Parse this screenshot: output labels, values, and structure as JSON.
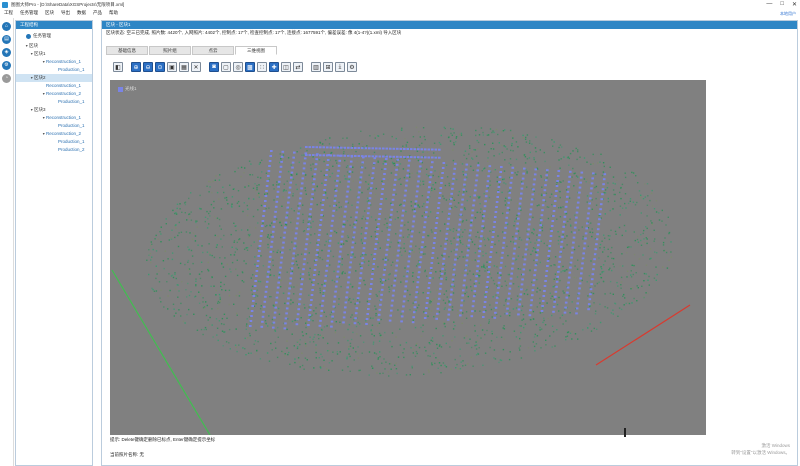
{
  "window": {
    "title": "图图大师Pro - [D:\\ShareData\\XGSProjects\\无限项目.xml]",
    "minimize": "—",
    "maximize": "□",
    "close": "✕",
    "user": "本地用户"
  },
  "menu": [
    "工程",
    "任务管理",
    "区块",
    "导出",
    "数据",
    "产品",
    "帮助"
  ],
  "left_rail": {
    "buttons": [
      {
        "icon": "home-icon",
        "glyph": "⌂"
      },
      {
        "icon": "folder-icon",
        "glyph": "▤"
      },
      {
        "icon": "layers-icon",
        "glyph": "◈"
      },
      {
        "icon": "settings-icon",
        "glyph": "⚙"
      },
      {
        "icon": "clock-icon",
        "glyph": "◔"
      }
    ]
  },
  "tree_panel": {
    "header": "工程结构",
    "manage_button": "任务管理",
    "items": [
      {
        "label": "区块",
        "level": 0,
        "caret": "▼"
      },
      {
        "label": "区块1",
        "level": 1,
        "caret": "▼"
      },
      {
        "label": "Reconstruction_1",
        "level": 2,
        "caret": "▼"
      },
      {
        "label": "Production_1",
        "level": 3,
        "caret": ""
      },
      {
        "label": "区块2",
        "level": 1,
        "caret": "▼",
        "selected": true
      },
      {
        "label": "Reconstruction_1",
        "level": 2,
        "caret": ""
      },
      {
        "label": "Reconstruction_2",
        "level": 2,
        "caret": "▼"
      },
      {
        "label": "Production_1",
        "level": 3,
        "caret": ""
      },
      {
        "label": "区块3",
        "level": 1,
        "caret": "▼"
      },
      {
        "label": "Reconstruction_1",
        "level": 2,
        "caret": "▼"
      },
      {
        "label": "Production_1",
        "level": 3,
        "caret": ""
      },
      {
        "label": "Reconstruction_2",
        "level": 2,
        "caret": "▼"
      },
      {
        "label": "Production_1",
        "level": 3,
        "caret": ""
      },
      {
        "label": "Production_2",
        "level": 3,
        "caret": ""
      }
    ]
  },
  "main": {
    "header": "区块 - 区块1",
    "info": "区块状态: 空三已完成, 照片数: 4420个, 入网照片: 4402个, 控制点: 17个, 检查控制点: 17个, 连接点: 1677591个, 偏差误差: 像 4(1-4?)(1.xml) 导入区块",
    "tabs": [
      {
        "label": "基础信息",
        "active": false
      },
      {
        "label": "照片组",
        "active": false
      },
      {
        "label": "点云",
        "active": false
      },
      {
        "label": "三维视图",
        "active": true
      }
    ],
    "toolbar": [
      {
        "icon": "camera-icon",
        "glyph": "◧",
        "blue": false
      },
      {
        "icon": "gap",
        "glyph": "",
        "blue": false
      },
      {
        "icon": "zoom-in-icon",
        "glyph": "⊕",
        "blue": true
      },
      {
        "icon": "zoom-out-icon",
        "glyph": "⊖",
        "blue": true
      },
      {
        "icon": "zoom-fit-icon",
        "glyph": "⊙",
        "blue": true
      },
      {
        "icon": "select-icon",
        "glyph": "▣",
        "blue": false
      },
      {
        "icon": "image-icon",
        "glyph": "▦",
        "blue": false
      },
      {
        "icon": "delete-icon",
        "glyph": "✕",
        "blue": false
      },
      {
        "icon": "gap",
        "glyph": "",
        "blue": false
      },
      {
        "icon": "photo-icon",
        "glyph": "◙",
        "blue": true
      },
      {
        "icon": "frame-icon",
        "glyph": "▢",
        "blue": false
      },
      {
        "icon": "target-icon",
        "glyph": "◎",
        "blue": false
      },
      {
        "icon": "grid-icon",
        "glyph": "▩",
        "blue": true
      },
      {
        "icon": "points-icon",
        "glyph": "∷",
        "blue": false
      },
      {
        "icon": "add-icon",
        "glyph": "✚",
        "blue": true
      },
      {
        "icon": "cube-icon",
        "glyph": "◫",
        "blue": false
      },
      {
        "icon": "link-icon",
        "glyph": "⇄",
        "blue": false
      },
      {
        "icon": "gap",
        "glyph": "",
        "blue": false
      },
      {
        "icon": "tile-icon",
        "glyph": "▥",
        "blue": false
      },
      {
        "icon": "measure-icon",
        "glyph": "⊞",
        "blue": false
      },
      {
        "icon": "export-icon",
        "glyph": "⤓",
        "blue": false
      },
      {
        "icon": "settings-icon",
        "glyph": "⚙",
        "blue": false
      }
    ],
    "camera_label": "光线1",
    "status_hint": "提示: Delete键确定删除已标点, Enter键确定提示坐标",
    "status_selection": "当前照片名称: 无"
  },
  "watermark": {
    "line1": "激活 Windows",
    "line2": "转到\"设置\"以激活 Windows。"
  },
  "colors": {
    "header_blue": "#2f86c5",
    "viewport_gray": "#808080",
    "camera_blue": "#7a84e6",
    "point_green": "#2e8f5a",
    "axis_green": "#3fbf4f",
    "axis_red": "#d83a2f"
  }
}
